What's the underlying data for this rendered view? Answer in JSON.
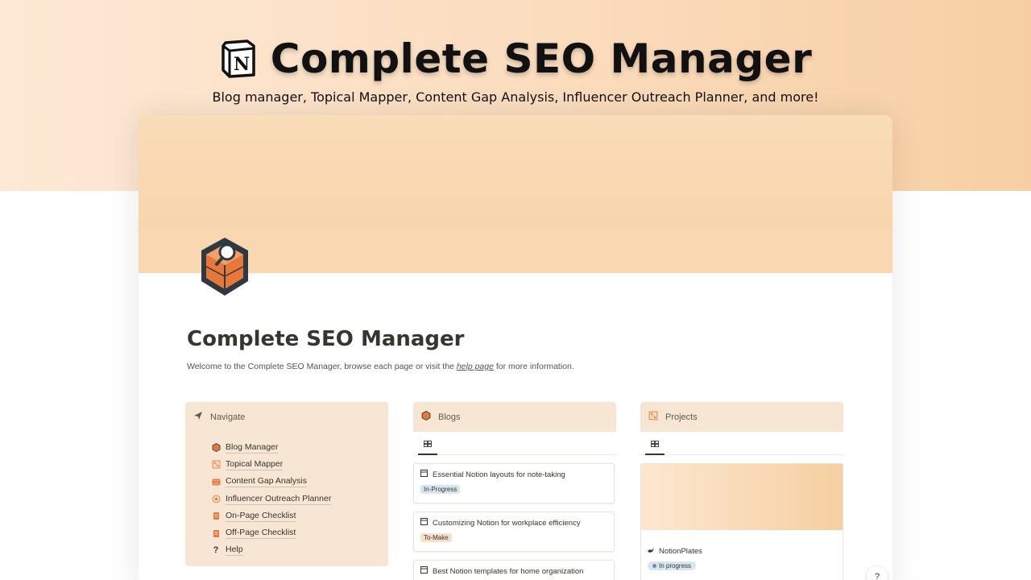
{
  "hero": {
    "title": "Complete SEO Manager",
    "subtitle": "Blog manager, Topical Mapper, Content Gap Analysis, Influencer Outreach Planner, and more!",
    "logo_icon": "notion-logo-icon"
  },
  "page": {
    "title": "Complete SEO Manager",
    "desc_before": "Welcome to the Complete SEO Manager, browse each page or visit the",
    "desc_link": "help page",
    "desc_after": "for more information."
  },
  "navigate": {
    "header": "Navigate",
    "items": [
      {
        "label": "Blog Manager",
        "icon": "cube-icon"
      },
      {
        "label": "Topical Mapper",
        "icon": "map-icon"
      },
      {
        "label": "Content Gap Analysis",
        "icon": "gap-icon"
      },
      {
        "label": "Influencer Outreach Planner",
        "icon": "outreach-icon"
      },
      {
        "label": "On-Page Checklist",
        "icon": "checklist-icon"
      },
      {
        "label": "Off-Page Checklist",
        "icon": "checklist-icon"
      },
      {
        "label": "Help",
        "icon": "question-icon"
      }
    ]
  },
  "blogs": {
    "header": "Blogs",
    "items": [
      {
        "title": "Essential Notion layouts for note-taking",
        "tag": "In-Progress"
      },
      {
        "title": "Customizing Notion for workplace efficiency",
        "tag": "To-Make"
      },
      {
        "title": "Best Notion templates for home organization",
        "tag": ""
      }
    ]
  },
  "projects": {
    "header": "Projects",
    "items": [
      {
        "name": "NotionPlates",
        "status": "In progress"
      }
    ]
  },
  "help_bubble": "?",
  "colors": {
    "accent_orange": "#e07b39",
    "card_bg": "#f8e6d4",
    "tag_blue": "#d8e6ef",
    "tag_orange": "#f9dfc9"
  }
}
